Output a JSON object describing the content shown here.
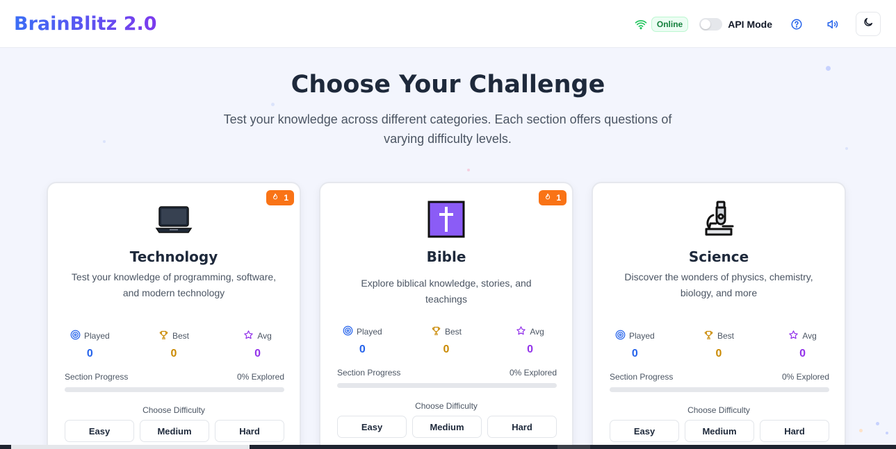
{
  "header": {
    "logo": "BrainBlitz 2.0",
    "status": "Online",
    "api_mode_label": "API Mode",
    "icons": [
      "wifi-icon",
      "help-icon",
      "volume-icon",
      "moon-icon"
    ]
  },
  "hero": {
    "title": "Choose Your Challenge",
    "subtitle": "Test your knowledge across different categories. Each section offers questions of varying difficulty levels."
  },
  "cards": [
    {
      "title": "Technology",
      "description": "Test your knowledge of programming, software, and modern technology",
      "icon": "laptop-icon",
      "streak": "1",
      "stats": {
        "played_label": "Played",
        "played": "0",
        "best_label": "Best",
        "best": "0",
        "avg_label": "Avg",
        "avg": "0"
      },
      "progress_label": "Section Progress",
      "progress_text": "0% Explored",
      "progress_percent": 0,
      "difficulty_label": "Choose Difficulty",
      "difficulties": [
        "Easy",
        "Medium",
        "Hard"
      ]
    },
    {
      "title": "Bible",
      "description": "Explore biblical knowledge, stories, and teachings",
      "icon": "cross-icon",
      "streak": "1",
      "stats": {
        "played_label": "Played",
        "played": "0",
        "best_label": "Best",
        "best": "0",
        "avg_label": "Avg",
        "avg": "0"
      },
      "progress_label": "Section Progress",
      "progress_text": "0% Explored",
      "progress_percent": 0,
      "difficulty_label": "Choose Difficulty",
      "difficulties": [
        "Easy",
        "Medium",
        "Hard"
      ]
    },
    {
      "title": "Science",
      "description": "Discover the wonders of physics, chemistry, biology, and more",
      "icon": "microscope-icon",
      "stats": {
        "played_label": "Played",
        "played": "0",
        "best_label": "Best",
        "best": "0",
        "avg_label": "Avg",
        "avg": "0"
      },
      "progress_label": "Section Progress",
      "progress_text": "0% Explored",
      "progress_percent": 0,
      "difficulty_label": "Choose Difficulty",
      "difficulties": [
        "Easy",
        "Medium",
        "Hard"
      ]
    }
  ],
  "colors": {
    "played": "#2563eb",
    "best": "#ca8a04",
    "avg": "#9333ea",
    "streak": "#f97316",
    "online": "#15803d"
  }
}
